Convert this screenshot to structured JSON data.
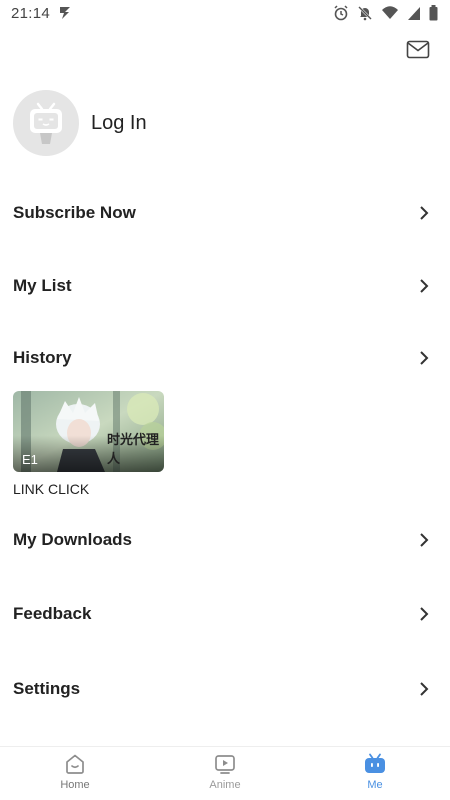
{
  "status_bar": {
    "time": "21:14",
    "icons": [
      "bolt-icon",
      "alarm-icon",
      "mute-icon",
      "wifi-icon",
      "signal-icon",
      "battery-icon"
    ]
  },
  "header": {
    "mail_icon": "mail-icon"
  },
  "profile": {
    "login_label": "Log In",
    "avatar_icon": "tv-avatar-icon"
  },
  "menu": {
    "subscribe": "Subscribe Now",
    "my_list": "My List",
    "history": "History",
    "downloads": "My Downloads",
    "feedback": "Feedback",
    "settings": "Settings"
  },
  "history_items": [
    {
      "episode": "E1",
      "title": "LINK CLICK",
      "thumb_text": "时光代理人"
    }
  ],
  "bottom_nav": {
    "items": [
      {
        "label": "Home",
        "icon": "home-icon"
      },
      {
        "label": "Anime",
        "icon": "play-icon"
      },
      {
        "label": "Me",
        "icon": "tv-me-icon"
      }
    ],
    "active_index": 2
  },
  "colors": {
    "accent": "#4a90e2",
    "inactive": "#9a9a9a",
    "text": "#222222"
  }
}
